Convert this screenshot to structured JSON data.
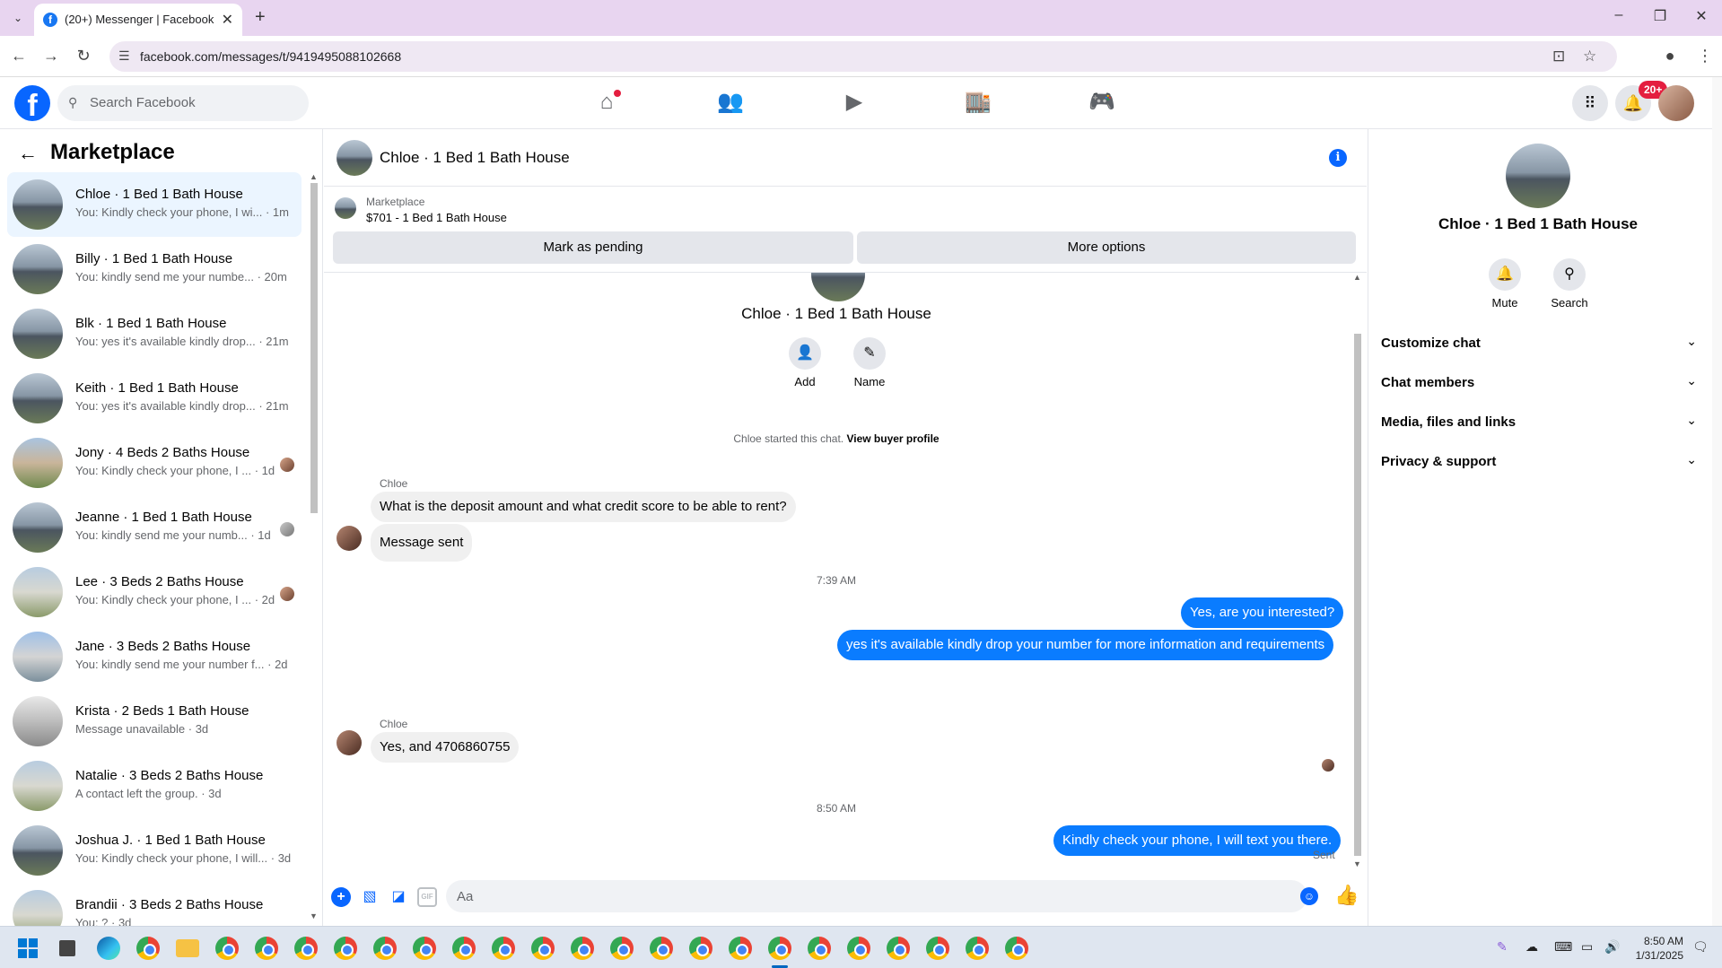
{
  "browser": {
    "tab_title": "(20+) Messenger | Facebook",
    "url": "facebook.com/messages/t/9419495088102668"
  },
  "fb_nav": {
    "search_placeholder": "Search Facebook",
    "notification_badge": "20+"
  },
  "sidebar": {
    "title": "Marketplace",
    "conversations": [
      {
        "name": "Chloe · 1 Bed 1 Bath House",
        "snippet": "You: Kindly check your phone, I wi... · 1m",
        "active": true
      },
      {
        "name": "Billy · 1 Bed 1 Bath House",
        "snippet": "You: kindly send me your numbe... · 20m"
      },
      {
        "name": "Blk · 1 Bed 1 Bath House",
        "snippet": "You: yes it's available kindly drop... · 21m"
      },
      {
        "name": "Keith · 1 Bed 1 Bath House",
        "snippet": "You: yes it's available kindly drop... · 21m"
      },
      {
        "name": "Jony · 4 Beds 2 Baths House",
        "snippet": "You: Kindly check your phone, I ... · 1d",
        "read": true
      },
      {
        "name": "Jeanne · 1 Bed 1 Bath House",
        "snippet": "You: kindly send me your numb... · 1d",
        "read": true
      },
      {
        "name": "Lee · 3 Beds 2 Baths House",
        "snippet": "You: Kindly check your phone, I ... · 2d",
        "read": true
      },
      {
        "name": "Jane · 3 Beds 2 Baths House",
        "snippet": "You: kindly send me your number f... · 2d"
      },
      {
        "name": "Krista · 2 Beds 1 Bath House",
        "snippet": "Message unavailable · 3d"
      },
      {
        "name": "Natalie · 3 Beds 2 Baths House",
        "snippet": "A contact left the group. · 3d"
      },
      {
        "name": "Joshua J. · 1 Bed 1 Bath House",
        "snippet": "You: Kindly check your phone, I will... · 3d"
      },
      {
        "name": "Brandii · 3 Beds 2 Baths House",
        "snippet": "You: ? · 3d"
      }
    ]
  },
  "chat": {
    "title": "Chloe · 1 Bed 1 Bath House",
    "marketplace_label": "Marketplace",
    "listing": "$701 - 1 Bed 1 Bath House",
    "mark_pending": "Mark as pending",
    "more_options": "More options",
    "thread_name": "Chloe · 1 Bed 1 Bath House",
    "add_label": "Add",
    "name_label": "Name",
    "started_text": "Chloe started this chat.",
    "view_profile": "View buyer profile",
    "sender1": "Chloe",
    "msg1": "What is the deposit amount and what credit score to be able to rent?",
    "msg2": "Message sent",
    "time1": "7:39 AM",
    "msg3": "Yes, are you interested?",
    "msg4": "yes it's available kindly drop your number for more information and requirements",
    "sender2": "Chloe",
    "msg5": "Yes, and 4706860755",
    "time2": "8:50 AM",
    "msg6": "Kindly check your phone, I will text you there.",
    "sent_label": "Sent",
    "composer_placeholder": "Aa",
    "gif_label": "GIF"
  },
  "right_panel": {
    "name": "Chloe · 1 Bed 1 Bath House",
    "mute_label": "Mute",
    "search_label": "Search",
    "sections": [
      "Customize chat",
      "Chat members",
      "Media, files and links",
      "Privacy & support"
    ]
  },
  "taskbar": {
    "time": "8:50 AM",
    "date": "1/31/2025"
  },
  "colors": {
    "fb_blue": "#0866ff",
    "outgoing_bubble": "#0a7cff",
    "incoming_bubble": "#f0f0f0",
    "badge_red": "#e41e3f"
  }
}
